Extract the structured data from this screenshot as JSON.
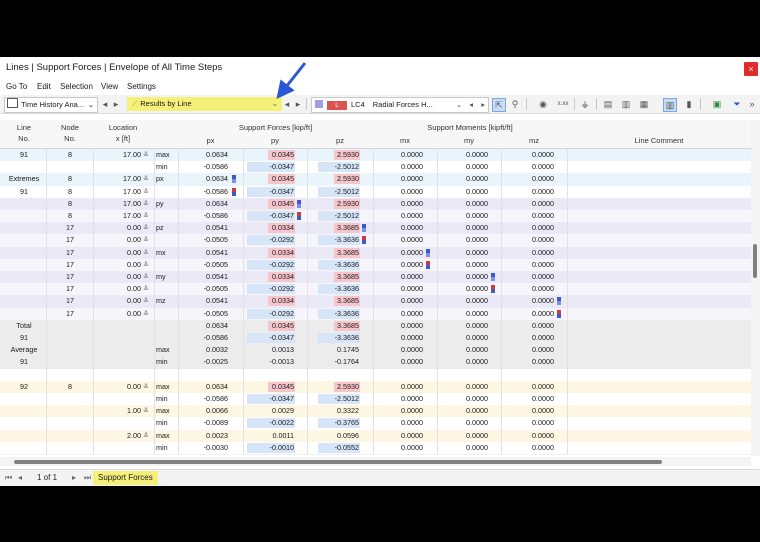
{
  "window": {
    "title": "Lines | Support Forces | Envelope of All Time Steps",
    "close": "×"
  },
  "menu": [
    "Go To",
    "Edit",
    "Selection",
    "View",
    "Settings"
  ],
  "toolbar": {
    "combo1": "Time History Ana...",
    "combo2": "Results by Line",
    "lc_badge": "L",
    "lc_label": "LC4",
    "lc_desc": "Radial Forces H...",
    "xxx": "x.xx",
    "more": "»"
  },
  "colors": {
    "pink": "#f7c6cd",
    "pink_edge": "#e89aa5",
    "blue": "#d6e6f8",
    "yellow_hl": "#f5f07a",
    "arrow": "#2b56d6"
  },
  "headers": {
    "line": "Line",
    "line_no": "No.",
    "node": "Node",
    "node_no": "No.",
    "location": "Location",
    "location_unit": "x [ft]",
    "forces_group": "Support Forces [kip/ft]",
    "px": "px",
    "py": "py",
    "pz": "pz",
    "moments_group": "Support Moments [kipft/ft]",
    "mx": "mx",
    "my": "my",
    "mz": "mz",
    "comment": "Line Comment"
  },
  "rows": [
    {
      "line": "91",
      "node": "8",
      "loc": "17.00",
      "type": "max",
      "px": "0.0634",
      "py": "0.0345",
      "pz": "2.5930",
      "mx": "0.0000",
      "my": "0.0000",
      "mz": "0.0000",
      "bg": "#eaf4fb"
    },
    {
      "line": "",
      "node": "",
      "loc": "",
      "type": "min",
      "px": "-0.0586",
      "py": "-0.0347",
      "pz": "-2.5012",
      "mx": "0.0000",
      "my": "0.0000",
      "mz": "0.0000",
      "bg": "#ffffff"
    },
    {
      "line": "Extremes",
      "node": "8",
      "loc": "17.00",
      "type": "px",
      "px": "0.0634",
      "py": "0.0345",
      "pz": "2.5930",
      "mx": "0.0000",
      "my": "0.0000",
      "mz": "0.0000",
      "bg": "#eaf4fb",
      "mark": "px"
    },
    {
      "line": "91",
      "node": "8",
      "loc": "17.00",
      "type": "",
      "px": "-0.0586",
      "py": "-0.0347",
      "pz": "-2.5012",
      "mx": "0.0000",
      "my": "0.0000",
      "mz": "0.0000",
      "bg": "#ffffff",
      "mark": "px2"
    },
    {
      "line": "",
      "node": "8",
      "loc": "17.00",
      "type": "py",
      "px": "0.0634",
      "py": "0.0345",
      "pz": "2.5930",
      "mx": "0.0000",
      "my": "0.0000",
      "mz": "0.0000",
      "bg": "#ece9f6",
      "mark": "py"
    },
    {
      "line": "",
      "node": "8",
      "loc": "17.00",
      "type": "",
      "px": "-0.0586",
      "py": "-0.0347",
      "pz": "-2.5012",
      "mx": "0.0000",
      "my": "0.0000",
      "mz": "0.0000",
      "bg": "#f6f5fb",
      "mark": "py2"
    },
    {
      "line": "",
      "node": "17",
      "loc": "0.00",
      "type": "pz",
      "px": "0.0541",
      "py": "0.0334",
      "pz": "3.3685",
      "mx": "0.0000",
      "my": "0.0000",
      "mz": "0.0000",
      "bg": "#ece9f6",
      "mark": "pz"
    },
    {
      "line": "",
      "node": "17",
      "loc": "0.00",
      "type": "",
      "px": "-0.0505",
      "py": "-0.0292",
      "pz": "-3.3636",
      "mx": "0.0000",
      "my": "0.0000",
      "mz": "0.0000",
      "bg": "#f6f5fb",
      "mark": "pz2"
    },
    {
      "line": "",
      "node": "17",
      "loc": "0.00",
      "type": "mx",
      "px": "0.0541",
      "py": "0.0334",
      "pz": "3.3685",
      "mx": "0.0000",
      "my": "0.0000",
      "mz": "0.0000",
      "bg": "#ece9f6",
      "mark": "mx"
    },
    {
      "line": "",
      "node": "17",
      "loc": "0.00",
      "type": "",
      "px": "-0.0505",
      "py": "-0.0292",
      "pz": "-3.3636",
      "mx": "0.0000",
      "my": "0.0000",
      "mz": "0.0000",
      "bg": "#f6f5fb",
      "mark": "mx2"
    },
    {
      "line": "",
      "node": "17",
      "loc": "0.00",
      "type": "my",
      "px": "0.0541",
      "py": "0.0334",
      "pz": "3.3685",
      "mx": "0.0000",
      "my": "0.0000",
      "mz": "0.0000",
      "bg": "#ece9f6",
      "mark": "my"
    },
    {
      "line": "",
      "node": "17",
      "loc": "0.00",
      "type": "",
      "px": "-0.0505",
      "py": "-0.0292",
      "pz": "-3.3636",
      "mx": "0.0000",
      "my": "0.0000",
      "mz": "0.0000",
      "bg": "#f6f5fb",
      "mark": "my2"
    },
    {
      "line": "",
      "node": "17",
      "loc": "0.00",
      "type": "mz",
      "px": "0.0541",
      "py": "0.0334",
      "pz": "3.3685",
      "mx": "0.0000",
      "my": "0.0000",
      "mz": "0.0000",
      "bg": "#ece9f6",
      "mark": "mz"
    },
    {
      "line": "",
      "node": "17",
      "loc": "0.00",
      "type": "",
      "px": "-0.0505",
      "py": "-0.0292",
      "pz": "-3.3636",
      "mx": "0.0000",
      "my": "0.0000",
      "mz": "0.0000",
      "bg": "#f6f5fb",
      "mark": "mz2"
    },
    {
      "line": "Total",
      "node": "",
      "loc": "",
      "type": "",
      "px": "0.0634",
      "py": "0.0345",
      "pz": "3.3685",
      "mx": "0.0000",
      "my": "0.0000",
      "mz": "0.0000",
      "bg": "#ececec"
    },
    {
      "line": "91",
      "node": "",
      "loc": "",
      "type": "",
      "px": "-0.0586",
      "py": "-0.0347",
      "pz": "-3.3636",
      "mx": "0.0000",
      "my": "0.0000",
      "mz": "0.0000",
      "bg": "#ececec"
    },
    {
      "line": "Average",
      "node": "",
      "loc": "",
      "type": "max",
      "px": "0.0032",
      "py": "0.0013",
      "pz": "0.1745",
      "mx": "0.0000",
      "my": "0.0000",
      "mz": "0.0000",
      "bg": "#ececec"
    },
    {
      "line": "91",
      "node": "",
      "loc": "",
      "type": "min",
      "px": "-0.0025",
      "py": "-0.0013",
      "pz": "-0.1764",
      "mx": "0.0000",
      "my": "0.0000",
      "mz": "0.0000",
      "bg": "#ececec"
    },
    {
      "blank": true,
      "bg": "#ffffff"
    },
    {
      "line": "92",
      "node": "8",
      "loc": "0.00",
      "type": "max",
      "px": "0.0634",
      "py": "0.0345",
      "pz": "2.5930",
      "mx": "0.0000",
      "my": "0.0000",
      "mz": "0.0000",
      "bg": "#fdf6e3"
    },
    {
      "line": "",
      "node": "",
      "loc": "",
      "type": "min",
      "px": "-0.0586",
      "py": "-0.0347",
      "pz": "-2.5012",
      "mx": "0.0000",
      "my": "0.0000",
      "mz": "0.0000",
      "bg": "#ffffff"
    },
    {
      "line": "",
      "node": "",
      "loc": "1.00",
      "type": "max",
      "px": "0.0066",
      "py": "0.0029",
      "pz": "0.3322",
      "mx": "0.0000",
      "my": "0.0000",
      "mz": "0.0000",
      "bg": "#fdf6e3"
    },
    {
      "line": "",
      "node": "",
      "loc": "",
      "type": "min",
      "px": "-0.0089",
      "py": "-0.0022",
      "pz": "-0.3765",
      "mx": "0.0000",
      "my": "0.0000",
      "mz": "0.0000",
      "bg": "#ffffff"
    },
    {
      "line": "",
      "node": "",
      "loc": "2.00",
      "type": "max",
      "px": "0.0023",
      "py": "0.0011",
      "pz": "0.0596",
      "mx": "0.0000",
      "my": "0.0000",
      "mz": "0.0000",
      "bg": "#fdf6e3"
    },
    {
      "line": "",
      "node": "",
      "loc": "",
      "type": "min",
      "px": "-0.0030",
      "py": "-0.0010",
      "pz": "-0.0552",
      "mx": "0.0000",
      "my": "0.0000",
      "mz": "0.0000",
      "bg": "#ffffff"
    }
  ],
  "footer": {
    "page": "1 of 1",
    "sheet_tab": "Support Forces"
  }
}
